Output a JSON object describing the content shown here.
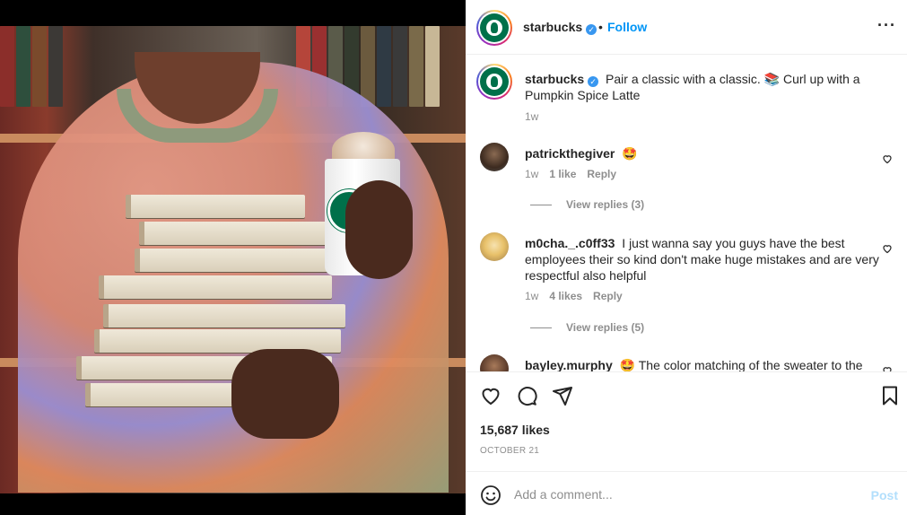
{
  "post": {
    "author": "starbucks",
    "follow_label": "Follow",
    "dot": "•",
    "more_icon": "more-horizontal-icon",
    "caption_text": "Pair a classic with a classic. 📚 Curl up with a Pumpkin Spice Latte",
    "caption_time": "1w",
    "likes": "15,687 likes",
    "date": "October 21"
  },
  "comments": [
    {
      "username": "patrickthegiver",
      "text": "🤩",
      "time": "1w",
      "likes": "1 like",
      "reply": "Reply",
      "view_replies": "View replies (3)"
    },
    {
      "username": "m0cha._.c0ff33",
      "text": "I just wanna say you guys have the best employees their so kind don't make huge mistakes and are very respectful also helpful",
      "time": "1w",
      "likes": "4 likes",
      "reply": "Reply",
      "view_replies": "View replies (5)"
    },
    {
      "username": "bayley.murphy",
      "text": "🤩 The color matching of the sweater to the"
    }
  ],
  "composer": {
    "placeholder": "Add a comment...",
    "post_label": "Post"
  },
  "colors": {
    "accent": "#0095f6",
    "verified": "#3897f0",
    "brand_green": "#00704a"
  }
}
